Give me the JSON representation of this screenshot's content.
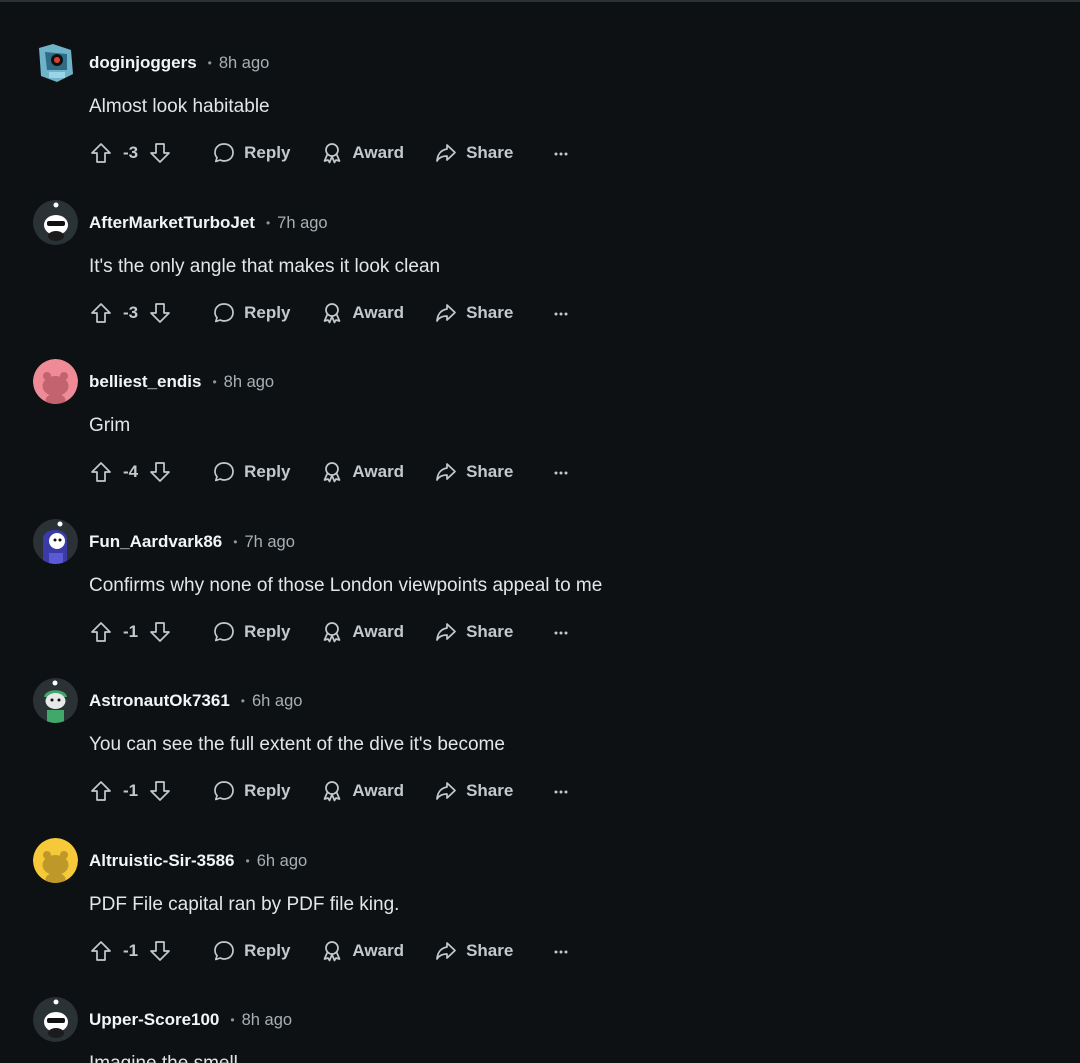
{
  "actions": {
    "reply_label": "Reply",
    "award_label": "Award",
    "share_label": "Share"
  },
  "icons": {
    "upvote": "upvote-icon",
    "downvote": "downvote-icon",
    "reply": "speech-bubble-icon",
    "award": "award-ribbon-icon",
    "share": "share-arrow-icon",
    "more": "ellipsis-icon"
  },
  "colors": {
    "background": "#0e1113",
    "username": "#f2f4f5",
    "meta": "#a7b0b4",
    "action": "#c3cace"
  },
  "comments": [
    {
      "username": "doginjoggers",
      "separator": "•",
      "time": "8h ago",
      "text": "Almost look habitable",
      "score": "-3",
      "avatar": "robot-avatar"
    },
    {
      "username": "AfterMarketTurboJet",
      "separator": "•",
      "time": "7h ago",
      "text": "It's the only angle that makes it look clean",
      "score": "-3",
      "avatar": "snoo-sunglasses-avatar"
    },
    {
      "username": "belliest_endis",
      "separator": "•",
      "time": "8h ago",
      "text": "Grim",
      "score": "-4",
      "avatar": "pink-default-snoo-avatar"
    },
    {
      "username": "Fun_Aardvark86",
      "separator": "•",
      "time": "7h ago",
      "text": "Confirms why none of those London viewpoints appeal to me",
      "score": "-1",
      "avatar": "purple-snoo-avatar"
    },
    {
      "username": "AstronautOk7361",
      "separator": "•",
      "time": "6h ago",
      "text": "You can see the full extent of the dive it's become",
      "score": "-1",
      "avatar": "green-snoo-avatar"
    },
    {
      "username": "Altruistic-Sir-3586",
      "separator": "•",
      "time": "6h ago",
      "text": "PDF File capital ran by PDF file king.",
      "score": "-1",
      "avatar": "yellow-default-snoo-avatar"
    },
    {
      "username": "Upper-Score100",
      "separator": "•",
      "time": "8h ago",
      "text": "Imagine the smell",
      "score": "",
      "avatar": "snoo-sunglasses-avatar"
    }
  ]
}
